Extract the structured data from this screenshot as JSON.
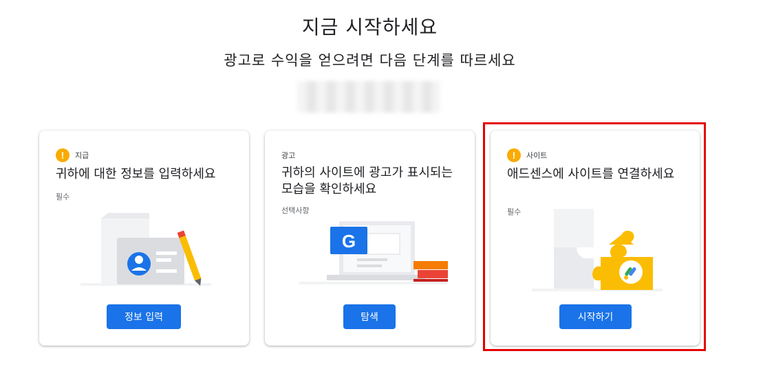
{
  "header": {
    "title": "지금 시작하세요",
    "subtitle": "광고로 수익을 얻으려면 다음 단계를 따르세요"
  },
  "cards": [
    {
      "category": "지급",
      "warning_icon": "warning-icon",
      "title": "귀하에 대한 정보를 입력하세요",
      "sub": "필수",
      "button": "정보 입력"
    },
    {
      "category": "광고",
      "title": "귀하의 사이트에 광고가 표시되는 모습을 확인하세요",
      "sub": "선택사항",
      "button": "탐색",
      "illustration_letter": "G"
    },
    {
      "category": "사이트",
      "warning_icon": "warning-icon",
      "title": "애드센스에 사이트를 연결하세요",
      "sub": "필수",
      "button": "시작하기"
    }
  ],
  "colors": {
    "primary_button": "#1a73e8",
    "warning": "#f9ab00",
    "highlight": "#e50000"
  }
}
